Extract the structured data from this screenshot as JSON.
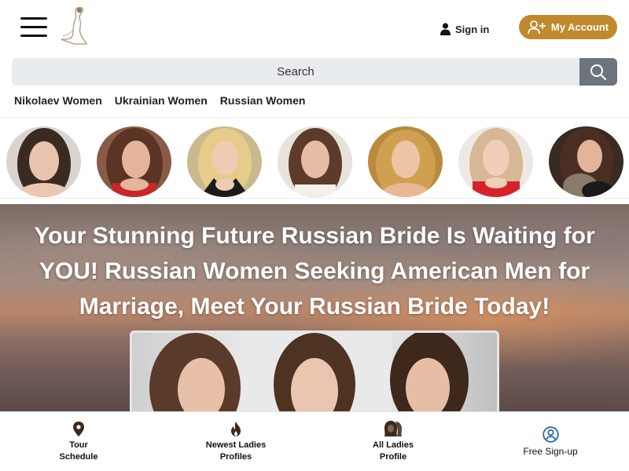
{
  "header": {
    "signin_label": "Sign in",
    "account_label": "My Account",
    "accent_color": "#c08a2c"
  },
  "search": {
    "placeholder": "Search"
  },
  "categories": [
    "Nikolaev Women",
    "Ukrainian Women",
    "Russian Women"
  ],
  "hero": {
    "title": "Your Stunning Future Russian Bride Is Waiting for YOU! Russian Women Seeking American Men for Marriage, Meet Your Russian Bride Today!"
  },
  "bottom_nav": [
    {
      "label": "Tour Schedule",
      "icon": "map-pin-icon"
    },
    {
      "label": "Newest Ladies Profiles",
      "icon": "fire-icon"
    },
    {
      "label": "All Ladies Profile",
      "icon": "ladies-icon"
    },
    {
      "label": "Free Sign-up",
      "icon": "user-circle-icon"
    }
  ],
  "icons": {
    "menu": "hamburger-menu-icon",
    "signin": "user-icon",
    "account": "user-plus-icon",
    "search": "search-icon",
    "logo": "bride-logo"
  }
}
